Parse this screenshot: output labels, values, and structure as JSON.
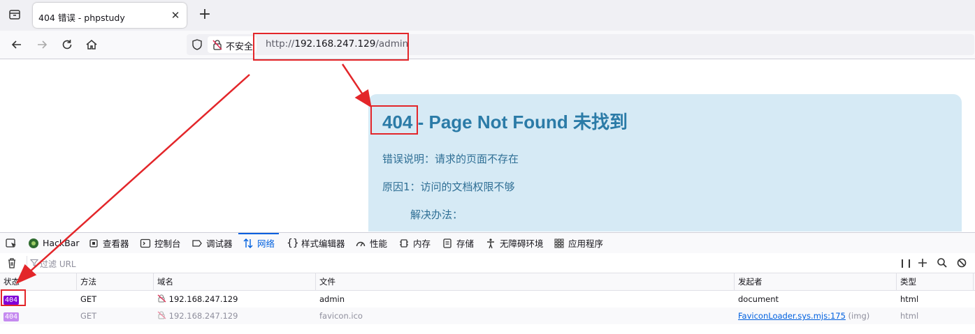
{
  "browser": {
    "tab": {
      "title": "404 错误 - phpstudy"
    },
    "new_tab_label": "+",
    "tab_close_label": "✕",
    "nav": {
      "security_label": "不安全",
      "url_scheme": "http://",
      "url_host": "192.168.247.129",
      "url_path": "/admin"
    }
  },
  "page": {
    "code": "404",
    "heading_rest": " - Page Not Found 未找到",
    "lines": [
      "错误说明：请求的页面不存在",
      "原因1：访问的文档权限不够",
      "解决办法："
    ]
  },
  "devtools": {
    "tabs": [
      {
        "label": "HackBar",
        "icon": "hackbar-icon"
      },
      {
        "label": "查看器",
        "icon": "inspector-icon"
      },
      {
        "label": "控制台",
        "icon": "console-icon"
      },
      {
        "label": "调试器",
        "icon": "debugger-icon"
      },
      {
        "label": "网络",
        "icon": "network-icon",
        "active": true
      },
      {
        "label": "样式编辑器",
        "icon": "style-editor-icon"
      },
      {
        "label": "性能",
        "icon": "performance-icon"
      },
      {
        "label": "内存",
        "icon": "memory-icon"
      },
      {
        "label": "存储",
        "icon": "storage-icon"
      },
      {
        "label": "无障碍环境",
        "icon": "accessibility-icon"
      },
      {
        "label": "应用程序",
        "icon": "application-icon"
      }
    ],
    "filter_placeholder": "过滤 URL",
    "columns": [
      "状态",
      "方法",
      "域名",
      "文件",
      "发起者",
      "类型"
    ],
    "requests": [
      {
        "status": "404",
        "method": "GET",
        "domain": "192.168.247.129",
        "file": "admin",
        "initiator": "document",
        "initiator_extra": "",
        "type": "html",
        "dim": false
      },
      {
        "status": "404",
        "method": "GET",
        "domain": "192.168.247.129",
        "file": "favicon.ico",
        "initiator": "FaviconLoader.sys.mjs:175",
        "initiator_extra": " (img)",
        "type": "html",
        "dim": true
      }
    ]
  },
  "colors": {
    "accent": "#0060df",
    "annotation_red": "#e3262a",
    "status_badge": "#8000d7",
    "error_box_bg": "#d6eaf5",
    "error_heading": "#2b7ba7"
  }
}
